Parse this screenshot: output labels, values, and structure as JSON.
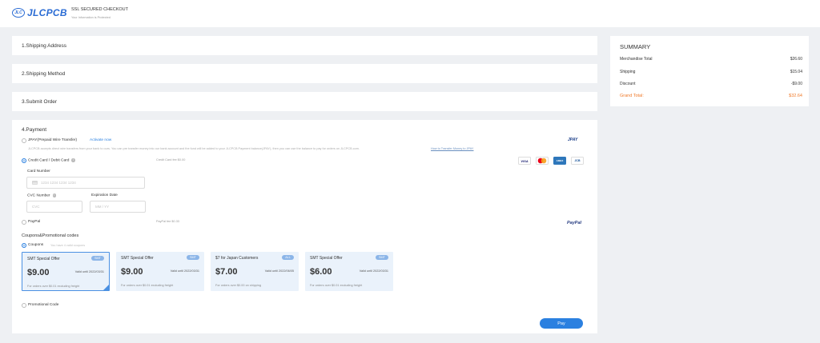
{
  "header": {
    "logo_mark": "JLC",
    "logo_text": "JLCPCB",
    "ssl_title": "SSL SECURED CHECKOUT",
    "ssl_subtitle": "Your Information is Protected"
  },
  "sections": {
    "shipping_address": "1.Shipping Address",
    "shipping_method": "2.Shipping Method",
    "submit_order": "3.Submit Order",
    "payment": "4.Payment"
  },
  "payment": {
    "jpay_label": "JPAY(Prepaid Wire Transfer)",
    "jpay_activate": "Activate now",
    "jpay_desc": "JLCPCB accepts direct wire transfers from your bank to ours. You can pre transfer money into our bank account and the fund will be added to your JLCPCB Payment balance(JPAY), then you can use the balance to pay for orders on JLCPCB.com.",
    "jpay_link": "How to Transfer Money to JPAY",
    "jpay_logo": "JPAY",
    "card_label": "Credit Card / Debit Card",
    "card_fee": "Credit Card fee $0.00",
    "card_brands": [
      "VISA",
      "MC",
      "AMEX",
      "JCB"
    ],
    "card_number_label": "Card Number",
    "card_number_placeholder": "1234 1234 1234 1234",
    "cvc_label": "CVC Number",
    "cvc_placeholder": "CVC",
    "expiration_label": "Expiration Date",
    "expiration_placeholder": "MM / YY",
    "paypal_label": "PayPal",
    "paypal_fee": "PayPal fee $0.33",
    "paypal_logo": "PayPal"
  },
  "coupons": {
    "section_label": "Coupons&Promotional codes",
    "coupons_label": "Coupons",
    "coupons_hint": "You have 4 valid coupons",
    "items": [
      {
        "title": "SMT Special Offer",
        "badge": "SMT",
        "amount": "$9.00",
        "valid": "Valid until 2022/03/31",
        "condition": "For orders over $0.01 excluding freight"
      },
      {
        "title": "SMT Special Offer",
        "badge": "SMT",
        "amount": "$9.00",
        "valid": "Valid until 2022/03/31",
        "condition": "For orders over $0.01 excluding freight"
      },
      {
        "title": "$7 for Japan Customers",
        "badge": "ALL",
        "amount": "$7.00",
        "valid": "Valid until 2022/06/05",
        "condition": "For orders over $0.00 on shipping"
      },
      {
        "title": "SMT Special Offer",
        "badge": "SMT",
        "amount": "$6.00",
        "valid": "Valid until 2022/03/31",
        "condition": "For orders over $0.01 excluding freight"
      }
    ],
    "promo_label": "Promotional Code",
    "pay_button": "Pay"
  },
  "summary": {
    "title": "SUMMARY",
    "merchandise_label": "Merchandise Total",
    "merchandise_value": "$26.60",
    "shipping_label": "Shipping",
    "shipping_value": "$15.04",
    "discount_label": "Discount",
    "discount_value": "-$9.00",
    "grand_label": "Grand Total:",
    "grand_value": "$32.64"
  },
  "colors": {
    "accent": "#2b80e0",
    "grand_total": "#f07a2a",
    "coupon_bg": "#eaf2fb"
  }
}
